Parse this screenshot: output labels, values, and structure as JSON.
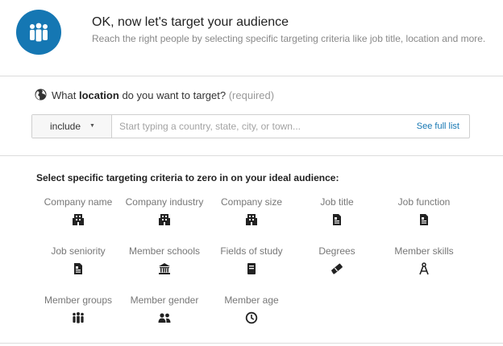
{
  "header": {
    "avatar_icon": "people-group-icon",
    "title": "OK, now let's target your audience",
    "subtitle": "Reach the right people by selecting specific targeting criteria like job title, location and more."
  },
  "location": {
    "question_prefix": "What",
    "question_bold": "location",
    "question_suffix": "do you want to target?",
    "required": "(required)",
    "include_label": "include",
    "input_placeholder": "Start typing a country, state, city, or town...",
    "see_full_list": "See full list"
  },
  "criteria": {
    "title": "Select specific targeting criteria to zero in on your ideal audience:",
    "items": [
      {
        "label": "Company name",
        "icon": "building-icon"
      },
      {
        "label": "Company industry",
        "icon": "building-icon"
      },
      {
        "label": "Company size",
        "icon": "building-icon"
      },
      {
        "label": "Job title",
        "icon": "id-card-icon"
      },
      {
        "label": "Job function",
        "icon": "id-card-icon"
      },
      {
        "label": "Job seniority",
        "icon": "id-card-icon"
      },
      {
        "label": "Member schools",
        "icon": "school-icon"
      },
      {
        "label": "Fields of study",
        "icon": "book-icon"
      },
      {
        "label": "Degrees",
        "icon": "diploma-icon"
      },
      {
        "label": "Member skills",
        "icon": "compass-icon"
      },
      {
        "label": "Member groups",
        "icon": "people-group-icon"
      },
      {
        "label": "Member gender",
        "icon": "people-pair-icon"
      },
      {
        "label": "Member age",
        "icon": "clock-icon"
      }
    ]
  },
  "colors": {
    "accent": "#1577b3",
    "link": "#1577b3",
    "icon": "#222222"
  }
}
